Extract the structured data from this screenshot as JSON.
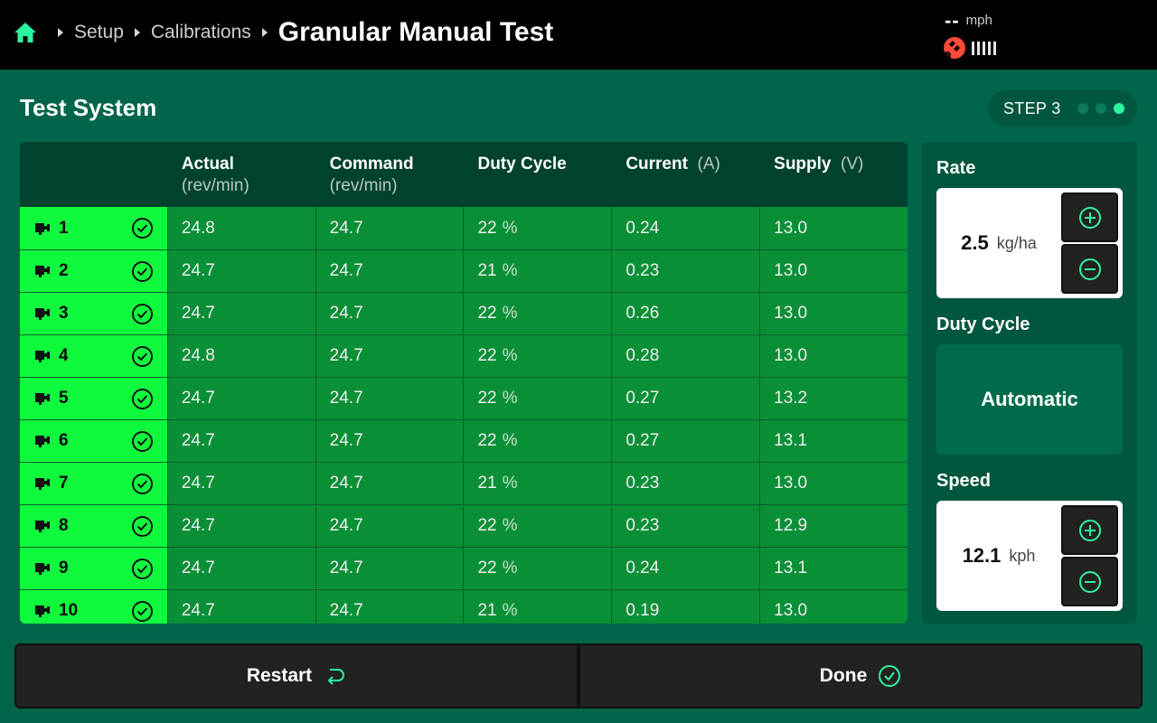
{
  "header": {
    "breadcrumbs": [
      "Setup",
      "Calibrations"
    ],
    "title": "Granular Manual Test",
    "speed_value": "--",
    "speed_unit": "mph"
  },
  "section": {
    "title": "Test System",
    "step_label": "STEP 3",
    "step_total": 3,
    "step_current": 3
  },
  "table": {
    "columns": [
      {
        "name": "Actual",
        "unit": "(rev/min)"
      },
      {
        "name": "Command",
        "unit": "(rev/min)"
      },
      {
        "name": "Duty Cycle",
        "unit": ""
      },
      {
        "name": "Current",
        "unit": "(A)"
      },
      {
        "name": "Supply",
        "unit": "(V)"
      }
    ],
    "rows": [
      {
        "id": "1",
        "actual": "24.8",
        "command": "24.7",
        "duty": "22",
        "duty_unit": "%",
        "current": "0.24",
        "supply": "13.0"
      },
      {
        "id": "2",
        "actual": "24.7",
        "command": "24.7",
        "duty": "21",
        "duty_unit": "%",
        "current": "0.23",
        "supply": "13.0"
      },
      {
        "id": "3",
        "actual": "24.7",
        "command": "24.7",
        "duty": "22",
        "duty_unit": "%",
        "current": "0.26",
        "supply": "13.0"
      },
      {
        "id": "4",
        "actual": "24.8",
        "command": "24.7",
        "duty": "22",
        "duty_unit": "%",
        "current": "0.28",
        "supply": "13.0"
      },
      {
        "id": "5",
        "actual": "24.7",
        "command": "24.7",
        "duty": "22",
        "duty_unit": "%",
        "current": "0.27",
        "supply": "13.2"
      },
      {
        "id": "6",
        "actual": "24.7",
        "command": "24.7",
        "duty": "22",
        "duty_unit": "%",
        "current": "0.27",
        "supply": "13.1"
      },
      {
        "id": "7",
        "actual": "24.7",
        "command": "24.7",
        "duty": "21",
        "duty_unit": "%",
        "current": "0.23",
        "supply": "13.0"
      },
      {
        "id": "8",
        "actual": "24.7",
        "command": "24.7",
        "duty": "22",
        "duty_unit": "%",
        "current": "0.23",
        "supply": "12.9"
      },
      {
        "id": "9",
        "actual": "24.7",
        "command": "24.7",
        "duty": "22",
        "duty_unit": "%",
        "current": "0.24",
        "supply": "13.1"
      },
      {
        "id": "10",
        "actual": "24.7",
        "command": "24.7",
        "duty": "21",
        "duty_unit": "%",
        "current": "0.19",
        "supply": "13.0"
      }
    ]
  },
  "panel": {
    "rate_label": "Rate",
    "rate_value": "2.5",
    "rate_unit": "kg/ha",
    "duty_label": "Duty Cycle",
    "duty_value": "Automatic",
    "speed_label": "Speed",
    "speed_value": "12.1",
    "speed_unit": "kph"
  },
  "buttons": {
    "restart": "Restart",
    "done": "Done"
  },
  "colors": {
    "background": "#00654a",
    "header": "#000000",
    "row_id_bg": "#10fa3d",
    "row_bg": "#098f35",
    "accent": "#2cf5a0",
    "gps_warning": "#ff4b3a"
  },
  "icons": {
    "home": "home-icon",
    "gps": "satellite-icon",
    "meter": "meter-motor-icon",
    "check": "check-circle-icon",
    "restart": "restart-arrow-icon",
    "done": "check-circle-icon"
  }
}
